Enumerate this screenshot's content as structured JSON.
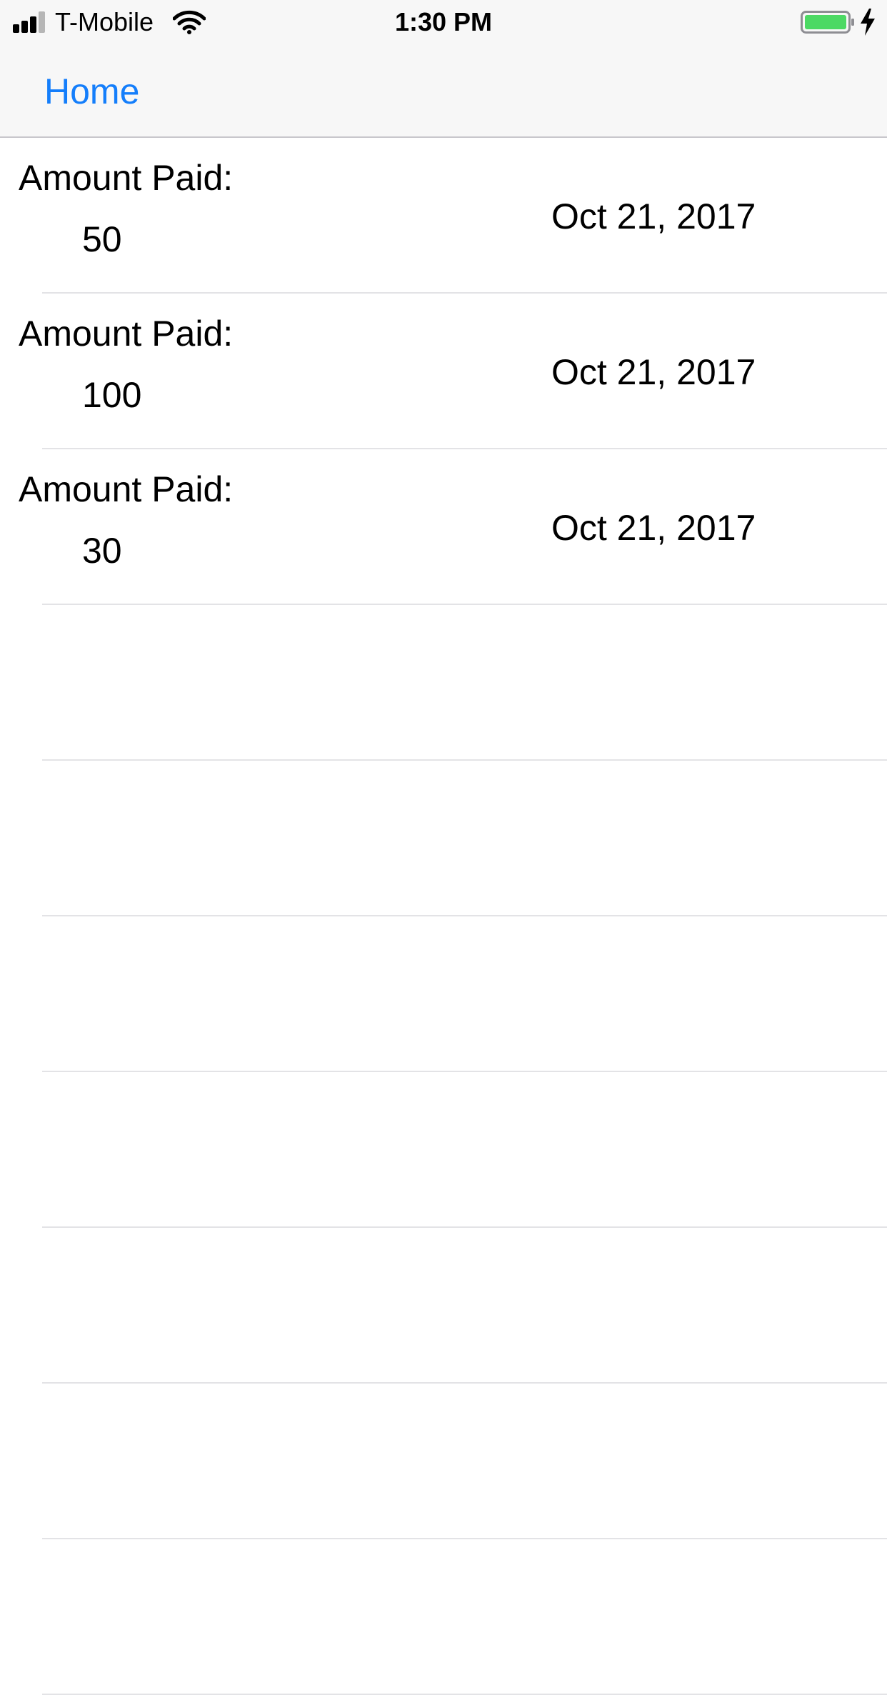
{
  "status_bar": {
    "carrier": "T-Mobile",
    "time": "1:30 PM",
    "battery_color": "#4cd964",
    "icons": [
      "cellular-signal-icon",
      "wifi-icon",
      "battery-icon",
      "charging-bolt-icon"
    ]
  },
  "nav_bar": {
    "back_label": "Home",
    "accent_color": "#147efb"
  },
  "payments": [
    {
      "label": "Amount Paid:",
      "amount": "50",
      "date": "Oct 21, 2017"
    },
    {
      "label": "Amount Paid:",
      "amount": "100",
      "date": "Oct 21, 2017"
    },
    {
      "label": "Amount Paid:",
      "amount": "30",
      "date": "Oct 21, 2017"
    },
    {
      "label": null,
      "amount": null,
      "date": null
    },
    {
      "label": null,
      "amount": null,
      "date": null
    },
    {
      "label": null,
      "amount": null,
      "date": null
    },
    {
      "label": null,
      "amount": null,
      "date": null
    },
    {
      "label": null,
      "amount": null,
      "date": null
    },
    {
      "label": null,
      "amount": null,
      "date": null
    },
    {
      "label": null,
      "amount": null,
      "date": null
    }
  ]
}
